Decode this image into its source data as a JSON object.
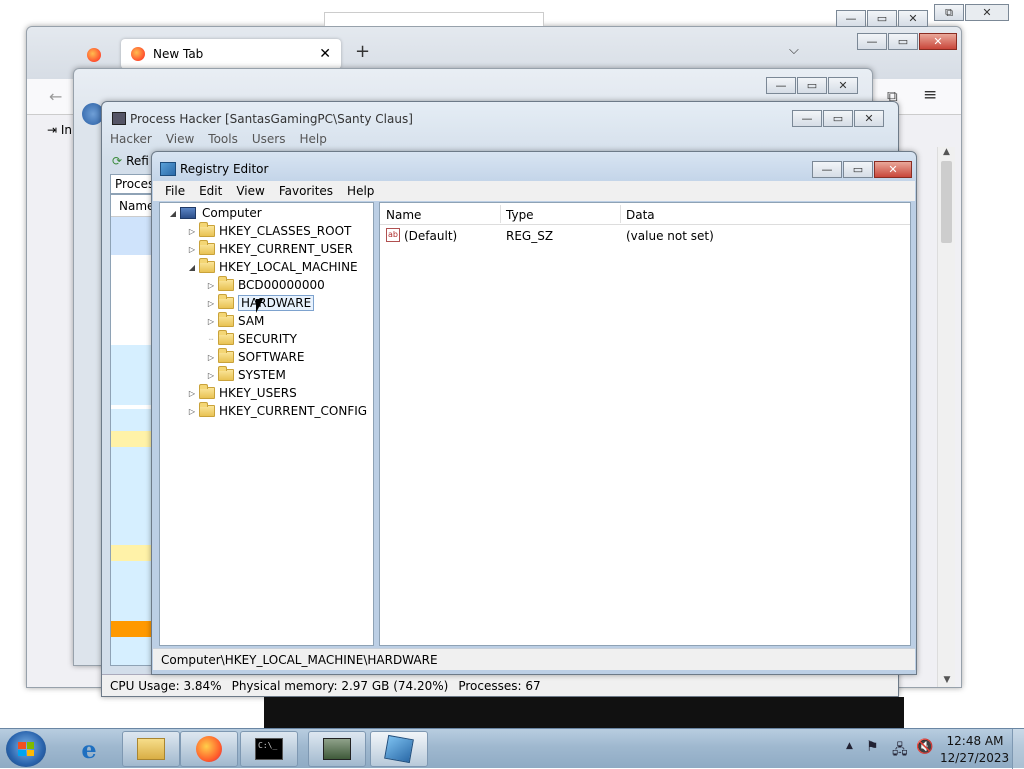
{
  "firefox": {
    "tab_label": "New Tab",
    "new_tab_symbol": "+",
    "sidebar_hint": "In"
  },
  "process_hacker": {
    "title": "Process Hacker [SantasGamingPC\\Santy Claus]",
    "menu": [
      "Hacker",
      "View",
      "Tools",
      "Users",
      "Help"
    ],
    "toolbar_refresh": "Refi",
    "tab_processes": "Process",
    "column_name": "Name",
    "status": {
      "cpu": "CPU Usage: 3.84%",
      "memory": "Physical memory: 2.97 GB (74.20%)",
      "processes": "Processes: 67"
    }
  },
  "regedit": {
    "title": "Registry Editor",
    "menu": [
      "File",
      "Edit",
      "View",
      "Favorites",
      "Help"
    ],
    "tree": {
      "root": "Computer",
      "hives": [
        "HKEY_CLASSES_ROOT",
        "HKEY_CURRENT_USER",
        "HKEY_LOCAL_MACHINE"
      ],
      "hklm_children": [
        "BCD00000000",
        "HARDWARE",
        "SAM",
        "SECURITY",
        "SOFTWARE",
        "SYSTEM"
      ],
      "hives_after": [
        "HKEY_USERS",
        "HKEY_CURRENT_CONFIG"
      ],
      "selected": "HARDWARE"
    },
    "list": {
      "columns": [
        "Name",
        "Type",
        "Data"
      ],
      "rows": [
        {
          "name": "(Default)",
          "type": "REG_SZ",
          "data": "(value not set)"
        }
      ]
    },
    "status_path": "Computer\\HKEY_LOCAL_MACHINE\\HARDWARE"
  },
  "taskbar": {
    "time": "12:48 AM",
    "date": "12/27/2023",
    "cmd_glyph": "C:\\_"
  },
  "colors": {
    "selection": "#cce8ff",
    "accent_close": "#c9463a",
    "ph_highlight_blue": "#d6efff",
    "ph_highlight_yellow": "#fff2a8",
    "ph_highlight_orange": "#ff9900"
  }
}
